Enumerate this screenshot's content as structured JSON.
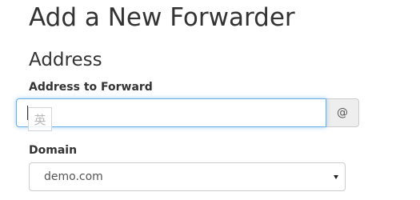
{
  "header": {
    "title": "Add a New Forwarder"
  },
  "address_section": {
    "title": "Address",
    "address_to_forward": {
      "label": "Address to Forward",
      "value": "",
      "addon": "@"
    },
    "ime_indicator": "英",
    "domain": {
      "label": "Domain",
      "selected": "demo.com"
    }
  },
  "colors": {
    "focus_border": "#66afe9",
    "addon_background": "#eeeeee",
    "text": "#333333"
  },
  "icons": {
    "select_arrow": "chevron-down-icon"
  }
}
